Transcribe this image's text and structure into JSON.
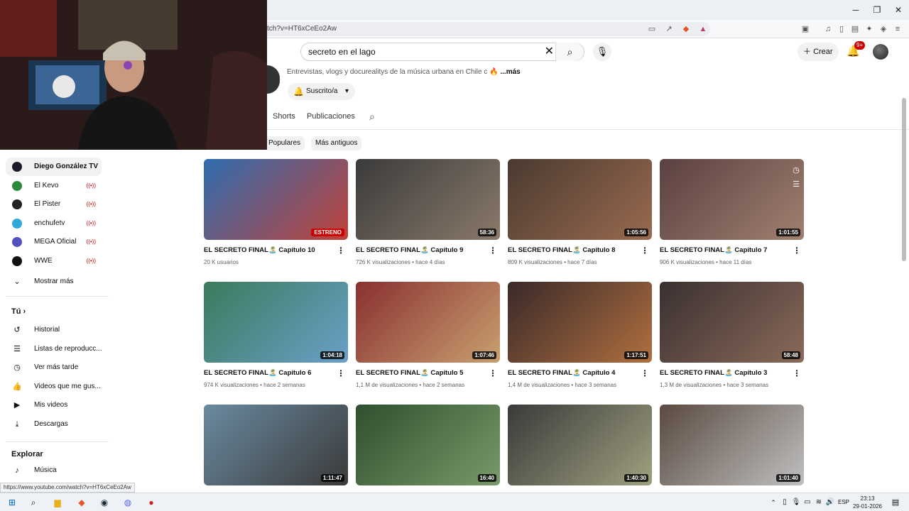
{
  "browser": {
    "url": "tch?v=HT6xCeEo2Aw",
    "status_url": "https://www.youtube.com/watch?v=HT6xCeEo2Aw",
    "window_minimize": "─",
    "window_maximize": "❐",
    "window_close": "✕"
  },
  "header": {
    "search_value": "secreto en el lago",
    "create_label": "Crear",
    "notif_badge": "9+"
  },
  "channel": {
    "description": "Entrevistas, vlogs y docurealitys de la música urbana en Chile c",
    "more_label": "...más",
    "subscribe_label": "Suscrito/a",
    "tabs": [
      "Shorts",
      "Publicaciones"
    ],
    "chips": [
      "Populares",
      "Más antiguos"
    ]
  },
  "videos": [
    {
      "title": "EL SECRETO FINAL🏝️ Capítulo 10",
      "meta": "20 K usuarios",
      "badge": "ESTRENO",
      "duration": ""
    },
    {
      "title": "EL SECRETO FINAL🏝️ Capítulo 9",
      "meta": "726 K visualizaciones • hace 4 días",
      "badge": "",
      "duration": "58:36"
    },
    {
      "title": "EL SECRETO FINAL🏝️ Capítulo 8",
      "meta": "809 K visualizaciones • hace 7 días",
      "badge": "",
      "duration": "1:05:56"
    },
    {
      "title": "EL SECRETO FINAL🏝️ Capítulo 7",
      "meta": "906 K visualizaciones • hace 11 días",
      "badge": "",
      "duration": "1:01:55"
    },
    {
      "title": "EL SECRETO FINAL🏝️ Capítulo 6",
      "meta": "974 K visualizaciones • hace 2 semanas",
      "badge": "",
      "duration": "1:04:18"
    },
    {
      "title": "EL SECRETO FINAL🏝️ Capítulo 5",
      "meta": "1,1 M de visualizaciones • hace 2 semanas",
      "badge": "",
      "duration": "1:07:46"
    },
    {
      "title": "EL SECRETO FINAL🏝️ Capítulo 4",
      "meta": "1,4 M de visualizaciones • hace 3 semanas",
      "badge": "",
      "duration": "1:17:51"
    },
    {
      "title": "EL SECRETO FINAL🏝️ Capítulo 3",
      "meta": "1,3 M de visualizaciones • hace 3 semanas",
      "badge": "",
      "duration": "58:48"
    },
    {
      "title": "",
      "meta": "",
      "badge": "",
      "duration": "1:11:47"
    },
    {
      "title": "",
      "meta": "",
      "badge": "",
      "duration": "16:40"
    },
    {
      "title": "",
      "meta": "",
      "badge": "",
      "duration": "1:40:30"
    },
    {
      "title": "",
      "meta": "",
      "badge": "",
      "duration": "1:01:40"
    }
  ],
  "sidebar": {
    "subscriptions": [
      {
        "label": "Diego González TV",
        "live": false,
        "active": true
      },
      {
        "label": "El Kevo",
        "live": true,
        "active": false
      },
      {
        "label": "El Pister",
        "live": true,
        "active": false
      },
      {
        "label": "enchufetv",
        "live": true,
        "active": false
      },
      {
        "label": "MEGA Oficial",
        "live": true,
        "active": false
      },
      {
        "label": "WWE",
        "live": true,
        "active": false
      }
    ],
    "show_more": "Mostrar más",
    "you_heading": "Tú",
    "you_items": [
      "Historial",
      "Listas de reproducc...",
      "Ver más tarde",
      "Videos que me gus...",
      "Mis videos",
      "Descargas"
    ],
    "explore_heading": "Explorar",
    "explore_items": [
      "Música"
    ]
  },
  "taskbar": {
    "language": "ESP",
    "time": "23:13",
    "date": "29-01-2026"
  },
  "colors": {
    "youtube_red": "#cc0000",
    "thumb_gradients": [
      [
        "#2f6db0",
        "#c0423a"
      ],
      [
        "#3b3b3b",
        "#8a7a6a"
      ],
      [
        "#4a3a30",
        "#9a6a50"
      ],
      [
        "#5a4040",
        "#a08070"
      ],
      [
        "#3c7a5c",
        "#6aa0c8"
      ],
      [
        "#8a3030",
        "#c8a070"
      ],
      [
        "#3a2a2a",
        "#b07040"
      ],
      [
        "#3a3030",
        "#8a6a5a"
      ],
      [
        "#6a8aa0",
        "#3a3a3a"
      ],
      [
        "#2f4f2f",
        "#7a9a6a"
      ],
      [
        "#3a3a3a",
        "#a0a080"
      ],
      [
        "#5a4a40",
        "#c0c0c0"
      ]
    ]
  }
}
